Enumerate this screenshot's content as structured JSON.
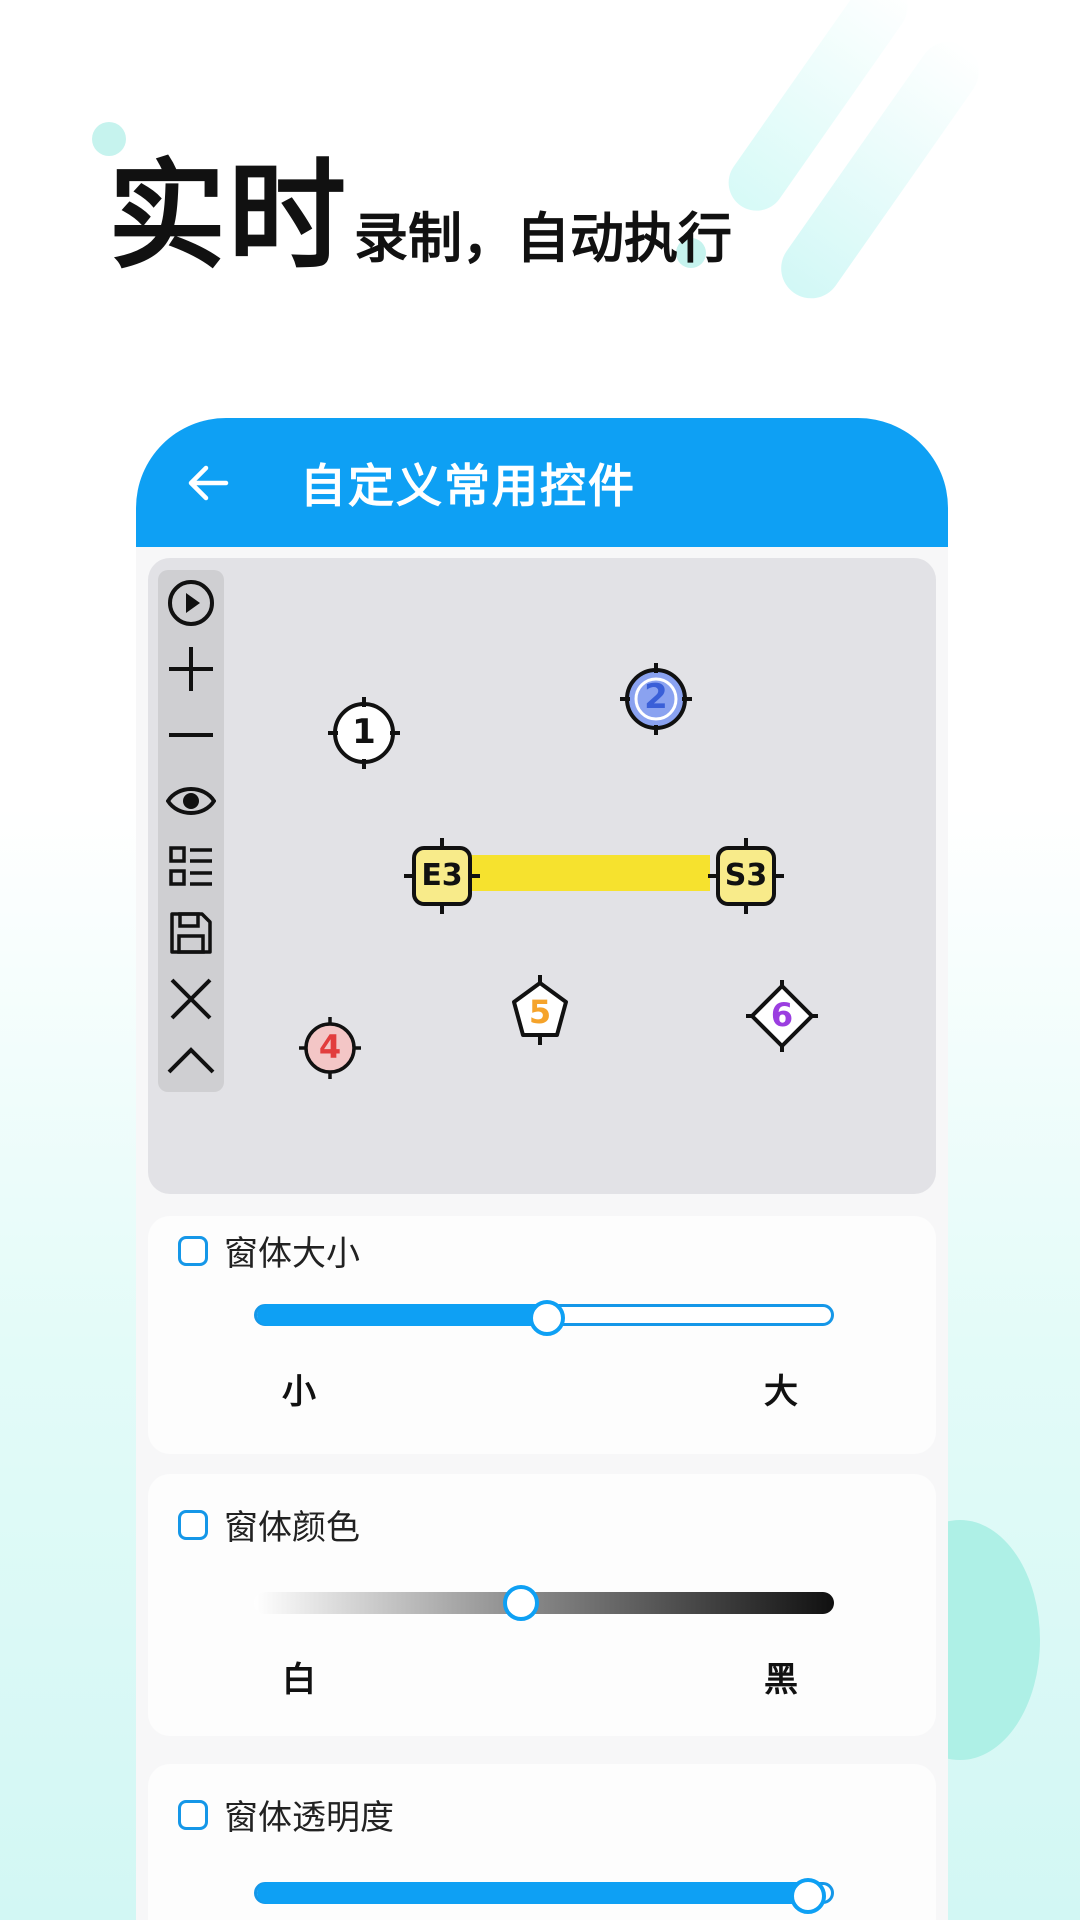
{
  "headline": {
    "big": "实时",
    "small": "录制，自动执行"
  },
  "screen": {
    "title": "自定义常用控件",
    "back_icon": "arrow-left-icon",
    "header_color": "#0ea0f4"
  },
  "toolbar": {
    "items": [
      "play-icon",
      "plus-icon",
      "minus-icon",
      "eye-icon",
      "list-icon",
      "save-icon",
      "close-icon",
      "chevron-up-icon"
    ]
  },
  "markers": {
    "m1": "1",
    "m2": "2",
    "e3": "E3",
    "s3": "S3",
    "m4": "4",
    "m5": "5",
    "m6": "6"
  },
  "settings": {
    "size": {
      "label": "窗体大小",
      "min": "小",
      "max": "大",
      "value": 0.5
    },
    "color": {
      "label": "窗体颜色",
      "min": "白",
      "max": "黑",
      "value": 0.46
    },
    "opacity": {
      "label": "窗体透明度",
      "value": 0.95
    }
  }
}
